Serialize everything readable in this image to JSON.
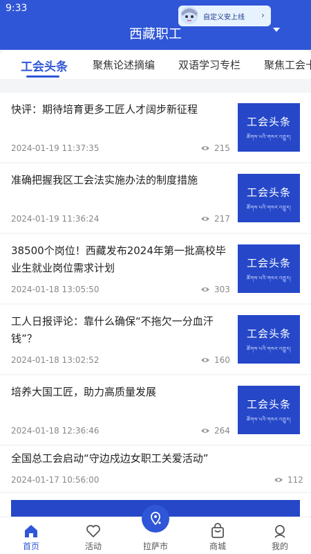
{
  "status_bar": {
    "time": "9:33"
  },
  "header": {
    "title": "西藏职工",
    "dropdown_icon": "caret-down-icon"
  },
  "promo": {
    "text": "自定义安上线",
    "arrow": "›"
  },
  "tabs": [
    {
      "label": "工会头条",
      "active": true
    },
    {
      "label": "聚焦论述摘编"
    },
    {
      "label": "双语学习专栏"
    },
    {
      "label": "聚焦工会十"
    }
  ],
  "thumbnail": {
    "title": "工会头条",
    "subtitle": "ཚོགས་པའི་གསར་འགྱུར།"
  },
  "articles": [
    {
      "title": "快评：期待培育更多工匠人才阔步新征程",
      "date": "2024-01-19 11:37:35",
      "views": "215"
    },
    {
      "title": "准确把握我区工会法实施办法的制度措施",
      "date": "2024-01-19 11:36:24",
      "views": "217"
    },
    {
      "title": "38500个岗位！西藏发布2024年第一批高校毕业生就业岗位需求计划",
      "date": "2024-01-18 13:05:50",
      "views": "303"
    },
    {
      "title": "工人日报评论：靠什么确保“不拖欠一分血汗钱”？",
      "date": "2024-01-18 13:02:52",
      "views": "160"
    },
    {
      "title": "培养大国工匠，助力高质量发展",
      "date": "2024-01-18 12:36:46",
      "views": "264"
    },
    {
      "title": "全国总工会启动“守边戍边女职工关爱活动”",
      "date": "2024-01-17 10:56:00",
      "views": "112"
    }
  ],
  "bottom_nav": [
    {
      "label": "首页",
      "icon": "home-icon",
      "active": true
    },
    {
      "label": "活动",
      "icon": "heart-icon"
    },
    {
      "label": "拉萨市",
      "icon": "location-icon"
    },
    {
      "label": "商城",
      "icon": "bag-icon"
    },
    {
      "label": "我的",
      "icon": "user-icon"
    }
  ],
  "colors": {
    "primary": "#2f56d6",
    "thumb": "#2547c8",
    "text": "#222222",
    "muted": "#888888"
  }
}
